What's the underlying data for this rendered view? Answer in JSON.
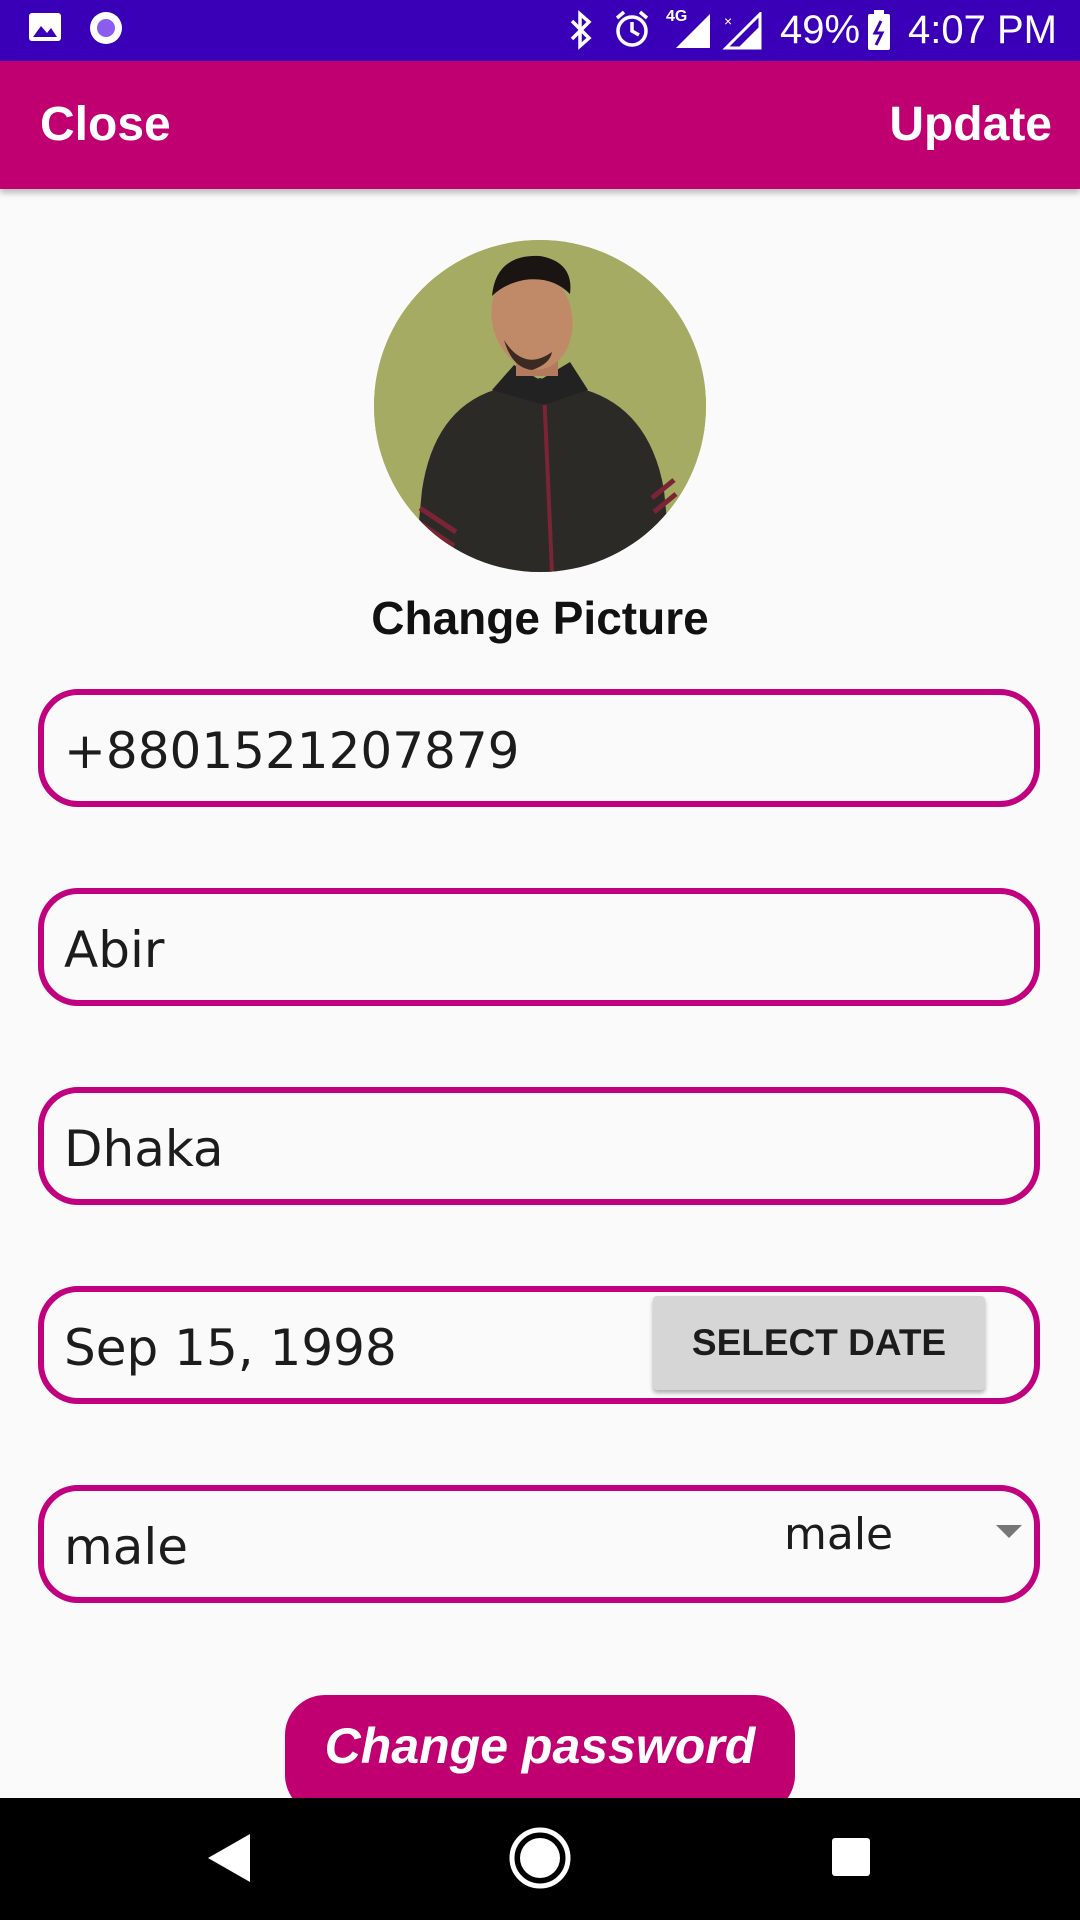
{
  "status_bar": {
    "battery": "49%",
    "time": "4:07 PM",
    "network_badge": "4G",
    "icons": [
      "image-icon",
      "record-icon",
      "bluetooth-icon",
      "alarm-icon",
      "signal-4g-icon",
      "signal-x-icon",
      "battery-icon"
    ]
  },
  "app_bar": {
    "close_label": "Close",
    "update_label": "Update",
    "color": "#c00071"
  },
  "profile": {
    "change_picture_label": "Change Picture"
  },
  "form": {
    "phone": "+8801521207879",
    "name": "Abir",
    "city": "Dhaka",
    "dob": "Sep 15, 1998",
    "select_date_label": "SELECT DATE",
    "gender_text": "male",
    "gender_selected": "male",
    "border_color": "#c0007f"
  },
  "actions": {
    "change_password_label": "Change password"
  },
  "nav": {
    "icons": [
      "back-icon",
      "home-icon",
      "recents-icon"
    ]
  }
}
